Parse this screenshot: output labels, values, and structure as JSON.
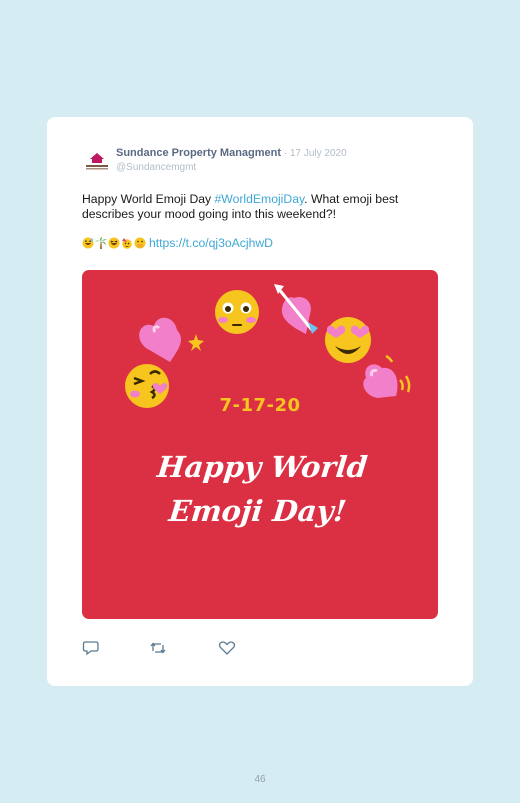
{
  "tweet": {
    "author_name": "Sundance Property Managment",
    "separator": " · ",
    "date": "17 July 2020",
    "handle": "@Sundancemgmt",
    "text_before_hashtag": "Happy World Emoji Day ",
    "hashtag": "#WorldEmojiDay",
    "text_after_hashtag": ". What emoji best describes your mood going into this weekend?!",
    "link": "https://t.co/qj3oAcjhwD"
  },
  "media": {
    "background_color": "#db3043",
    "date_text": "7-17-20",
    "headline_line1": "Happy World",
    "headline_line2": "Emoji Day!"
  },
  "actions": {
    "reply_icon": "reply-icon",
    "retweet_icon": "retweet-icon",
    "like_icon": "heart-icon"
  },
  "page": {
    "number": "46"
  },
  "colors": {
    "page_background": "#d6ecf3",
    "link_blue": "#3fa7d6",
    "name_gray": "#5a6a85",
    "meta_gray": "#b2bdc8",
    "emoji_yellow": "#f6c51e",
    "heart_pink": "#f27fc9"
  }
}
